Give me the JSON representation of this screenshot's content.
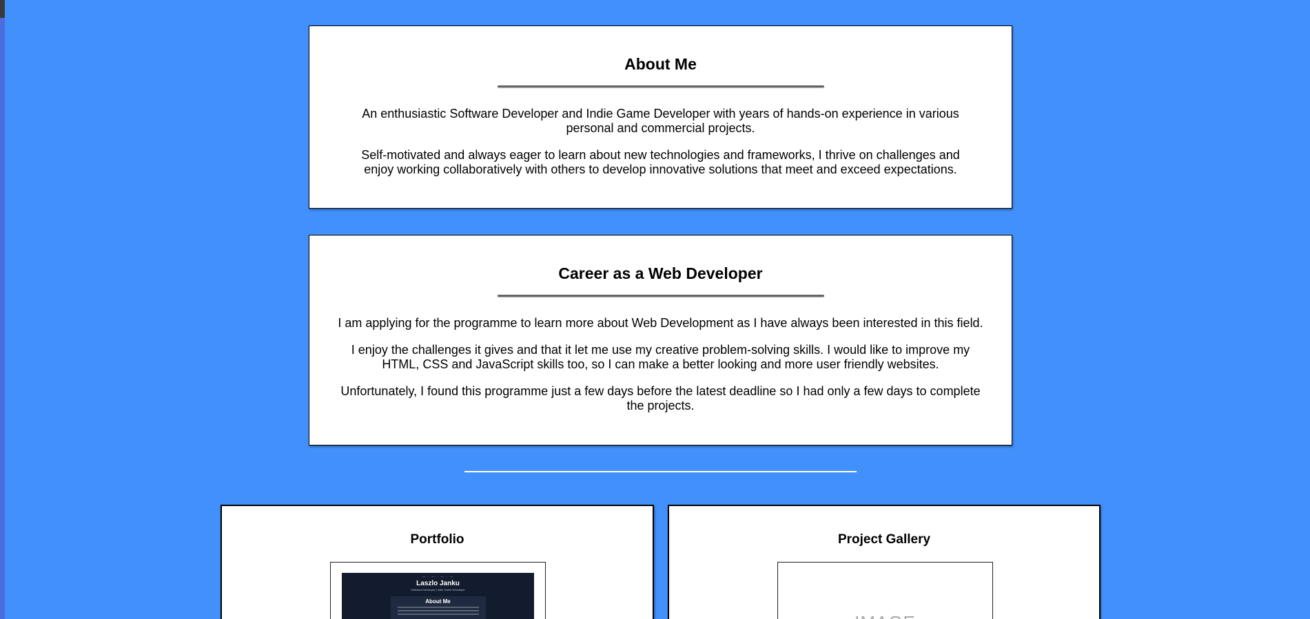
{
  "about": {
    "title": "About Me",
    "paragraphs": [
      "An enthusiastic Software Developer and Indie Game Developer with years of hands-on experience in various personal and commercial projects.",
      "Self-motivated and always eager to learn about new technologies and frameworks, I thrive on challenges and enjoy working collaboratively with others to develop innovative solutions that meet and exceed expectations."
    ]
  },
  "career": {
    "title": "Career as a Web Developer",
    "paragraphs": [
      "I am applying for the programme to learn more about Web Development as I have always been interested in this field.",
      "I enjoy the challenges it gives and that it let me use my creative problem-solving skills. I would like to improve my HTML, CSS and JavaScript skills too, so I can make a better looking and more user friendly websites.",
      "Unfortunately, I found this programme just a few days before the latest deadline so I had only a few days to complete the projects."
    ]
  },
  "portfolio": {
    "title": "Portfolio",
    "preview": {
      "nav": "— · — · — · —",
      "name": "Laszlo Janku",
      "subtitle": "Software Developer | Indie Game Developer",
      "section_title": "About Me"
    }
  },
  "gallery": {
    "title": "Project Gallery",
    "placeholder": "IMAGE"
  },
  "colors": {
    "background": "#4290fb",
    "card": "#ffffff",
    "preview_bg": "#131b2e"
  }
}
